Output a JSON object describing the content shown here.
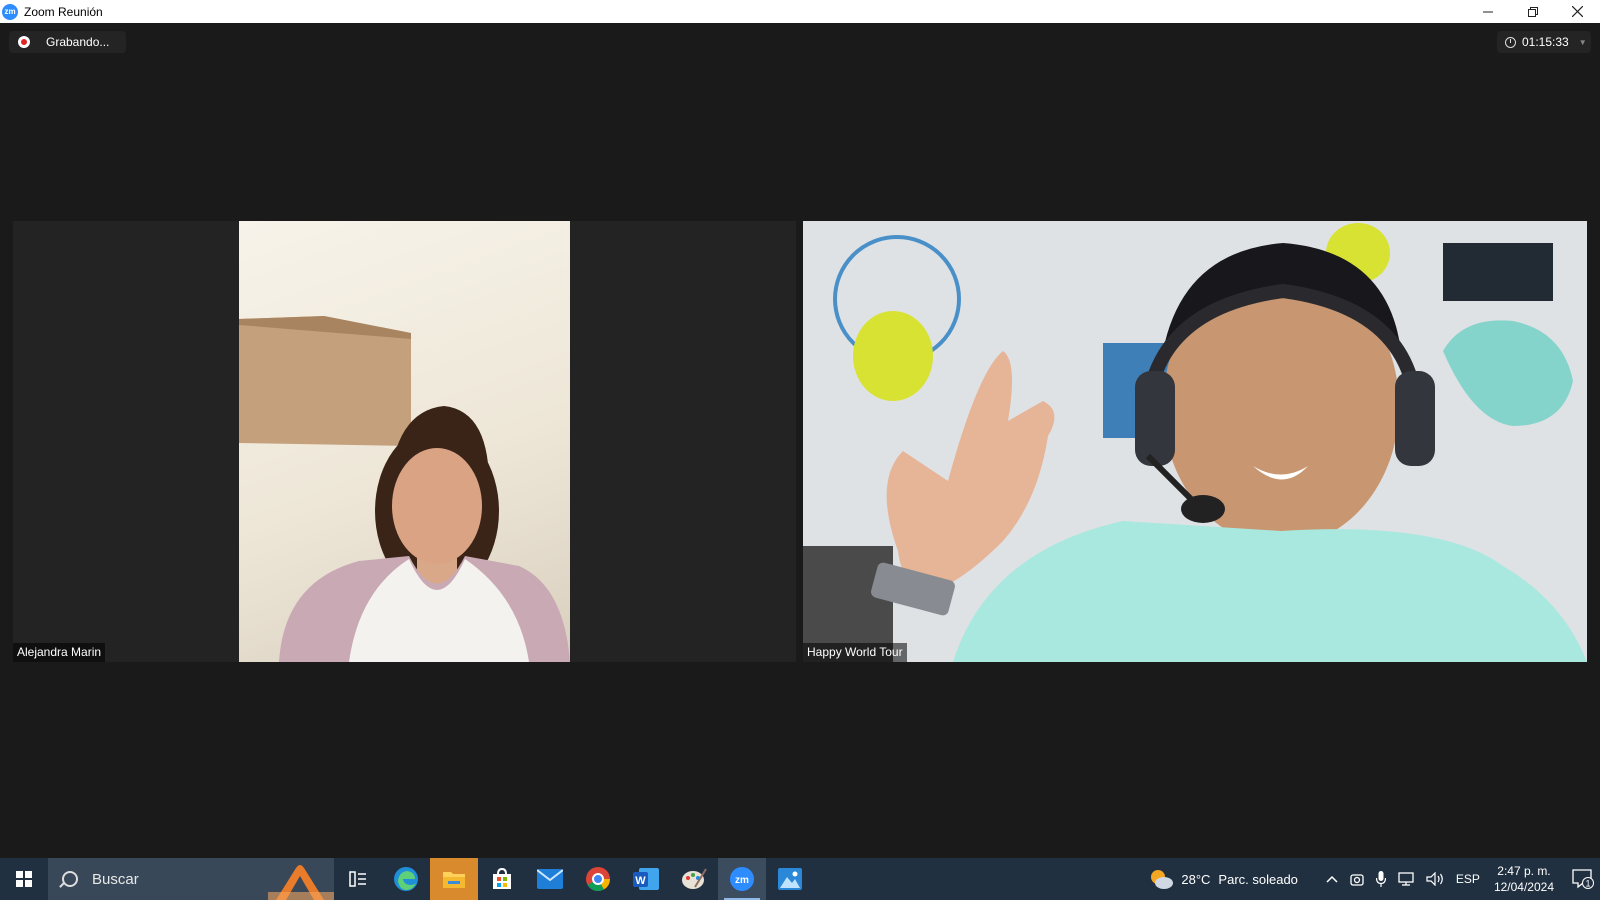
{
  "window": {
    "app_icon": "zm",
    "title": "Zoom Reunión",
    "controls": [
      "minimize-icon",
      "restore-icon",
      "close-icon"
    ]
  },
  "meeting": {
    "recording_label": "Grabando...",
    "timer": "01:15:33",
    "participants": [
      {
        "name": "Alejandra Marin"
      },
      {
        "name": "Happy World Tour"
      }
    ]
  },
  "taskbar": {
    "search_placeholder": "Buscar",
    "apps": [
      "task-view-icon",
      "edge-icon",
      "file-explorer-icon",
      "store-icon",
      "mail-icon",
      "chrome-icon",
      "word-icon",
      "paint-icon",
      "zoom-icon",
      "photos-icon"
    ],
    "app_labels": {
      "word": "W",
      "zoom": "zm"
    },
    "active_app": "zoom-icon",
    "weather": {
      "temp": "28°C",
      "desc": "Parc. soleado"
    },
    "language": "ESP",
    "time": "2:47 p. m.",
    "date": "12/04/2024",
    "notification_count": "1"
  },
  "colors": {
    "meeting_bg": "#1a1a1a",
    "taskbar_bg": "#203040",
    "zoom_blue": "#2d8cff",
    "recording_red": "#e02424"
  }
}
